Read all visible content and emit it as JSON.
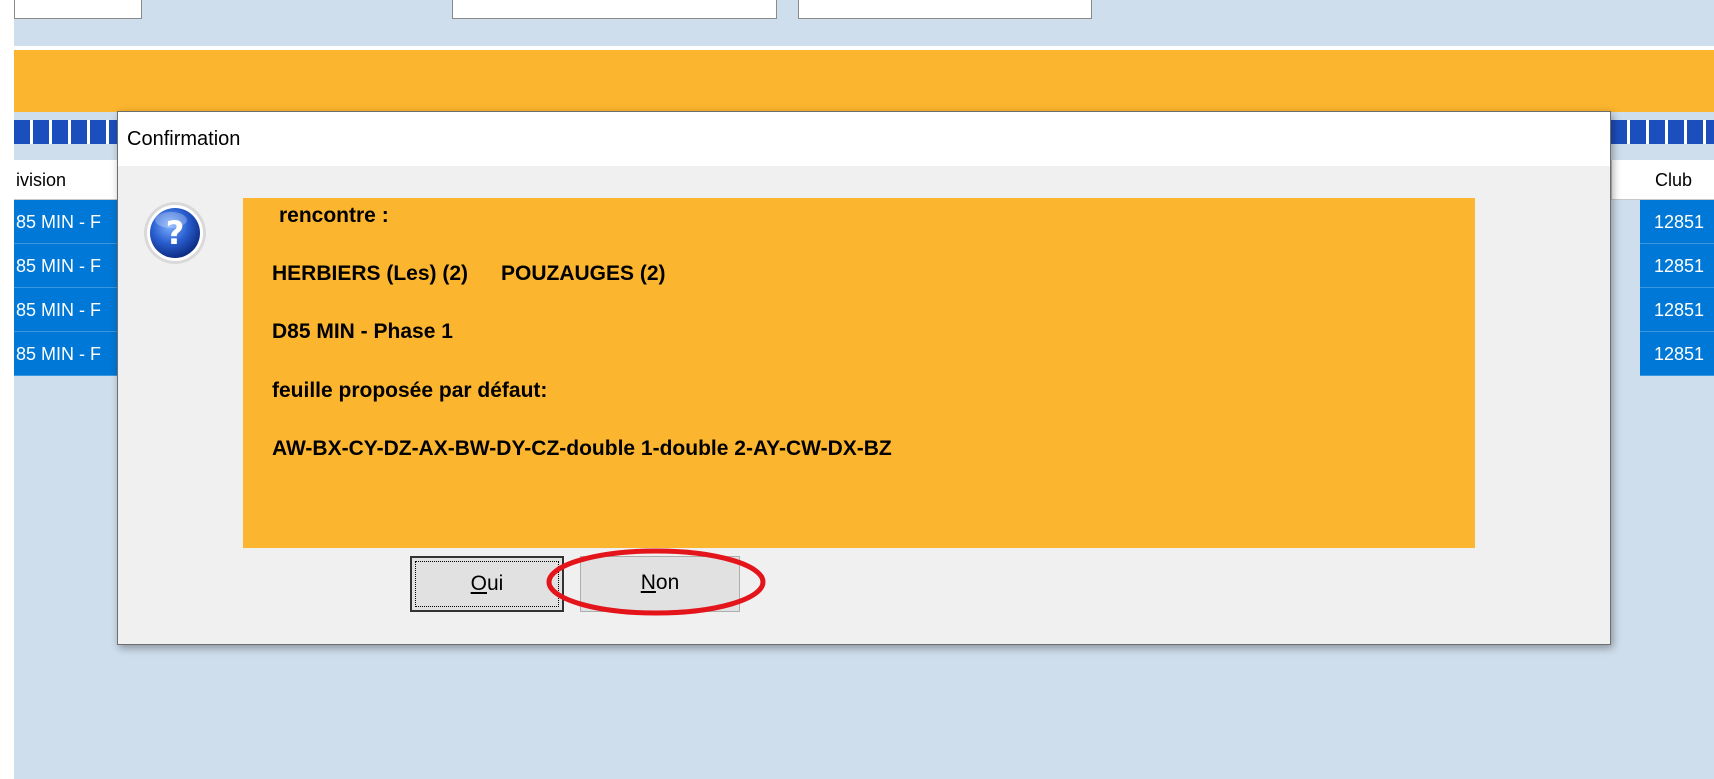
{
  "header": {
    "division_col": "ivision",
    "club_col": "Club"
  },
  "rows": [
    {
      "division": "85 MIN - F",
      "club": "12851"
    },
    {
      "division": "85 MIN - F",
      "club": "12851"
    },
    {
      "division": "85 MIN - F",
      "club": "12851"
    },
    {
      "division": "85 MIN - F",
      "club": "12851"
    }
  ],
  "dialog": {
    "title": "Confirmation",
    "icon": "question-icon",
    "message": {
      "line1": "rencontre :",
      "team_home": "HERBIERS (Les) (2)",
      "team_away": "POUZAUGES (2)",
      "division": "D85 MIN - Phase 1",
      "sheet_label": "feuille proposée par défaut:",
      "sheet_order": "AW-BX-CY-DZ-AX-BW-DY-CZ-double 1-double 2-AY-CW-DX-BZ"
    },
    "buttons": {
      "yes_mnemonic": "O",
      "yes_rest": "ui",
      "no_mnemonic": "N",
      "no_rest": "on"
    }
  },
  "colors": {
    "accent_orange": "#fbb52e",
    "selection_blue": "#0078d7",
    "annotation_red": "#e4141b"
  }
}
